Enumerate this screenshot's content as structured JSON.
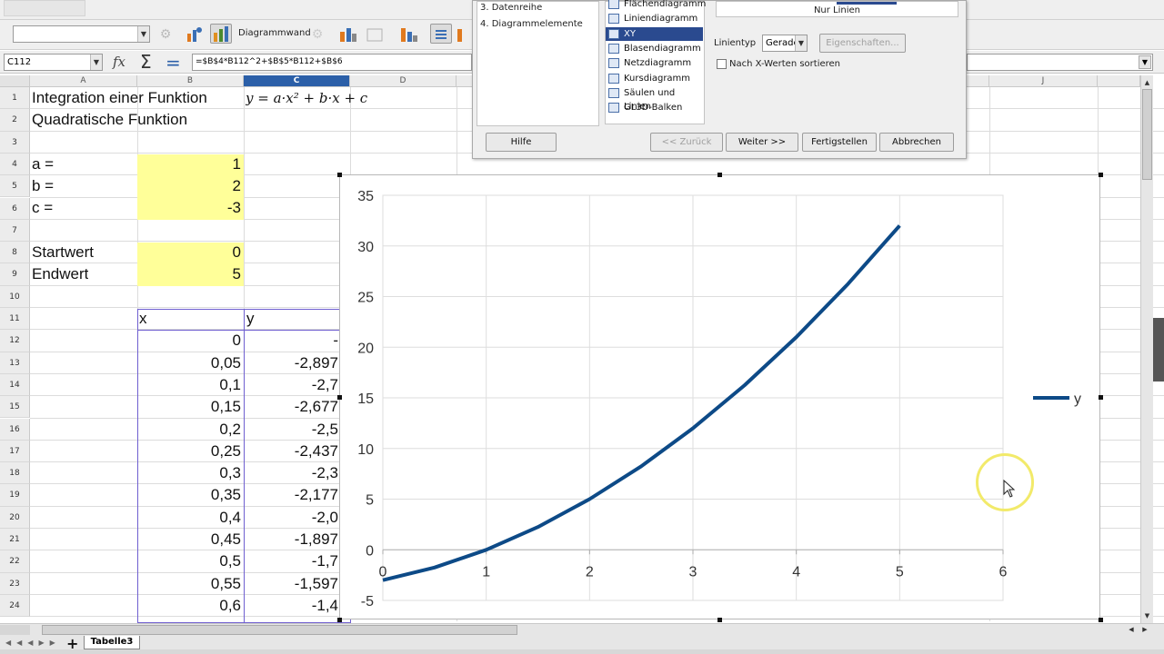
{
  "toolbar": {
    "diagrammwand_label": "Diagrammwand"
  },
  "formula_bar": {
    "name_box": "C112",
    "formula": "=$B$4*B112^2+$B$5*B112+$B$6"
  },
  "columns": [
    "A",
    "B",
    "C",
    "D",
    "J"
  ],
  "rows": [
    "1",
    "2",
    "3",
    "4",
    "5",
    "6",
    "7",
    "8",
    "9",
    "10",
    "11",
    "12",
    "13",
    "14",
    "15",
    "16",
    "17",
    "18",
    "19",
    "20",
    "21",
    "22",
    "23",
    "24"
  ],
  "cells": {
    "a1": "Integration einer Funktion",
    "c1_formula": "y = a·x² + b·x + c",
    "a2": "Quadratische Funktion",
    "a4": "a =",
    "b4": "1",
    "a5": "b =",
    "b5": "2",
    "a6": "c =",
    "b6": "-3",
    "a8": "Startwert",
    "b8": "0",
    "a9": "Endwert",
    "b9": "5",
    "b11": "x",
    "c11": "y"
  },
  "table_rows": [
    {
      "x": "0",
      "y": "-"
    },
    {
      "x": "0,05",
      "y": "-2,897"
    },
    {
      "x": "0,1",
      "y": "-2,7"
    },
    {
      "x": "0,15",
      "y": "-2,677"
    },
    {
      "x": "0,2",
      "y": "-2,5"
    },
    {
      "x": "0,25",
      "y": "-2,437"
    },
    {
      "x": "0,3",
      "y": "-2,3"
    },
    {
      "x": "0,35",
      "y": "-2,177"
    },
    {
      "x": "0,4",
      "y": "-2,0"
    },
    {
      "x": "0,45",
      "y": "-1,897"
    },
    {
      "x": "0,5",
      "y": "-1,7"
    },
    {
      "x": "0,55",
      "y": "-1,597"
    },
    {
      "x": "0,6",
      "y": "-1,4"
    }
  ],
  "dialog": {
    "steps": [
      "3. Datenreihe",
      "4. Diagrammelemente"
    ],
    "chart_types": [
      {
        "label": "Flächendiagramm",
        "selected": false
      },
      {
        "label": "Liniendiagramm",
        "selected": false
      },
      {
        "label": "XY (Streudiagramm)",
        "selected": true
      },
      {
        "label": "Blasendiagramm",
        "selected": false
      },
      {
        "label": "Netzdiagramm",
        "selected": false
      },
      {
        "label": "Kursdiagramm",
        "selected": false
      },
      {
        "label": "Säulen und Linien",
        "selected": false
      },
      {
        "label": "GL3D-Balken",
        "selected": false
      }
    ],
    "preview_caption": "Nur Linien",
    "linientyp_label": "Linientyp",
    "linientyp_value": "Gerade",
    "eigenschaften_label": "Eigenschaften...",
    "sort_checkbox_label": "Nach X-Werten sortieren",
    "buttons": {
      "hilfe": "Hilfe",
      "zurueck": "<< Zurück",
      "weiter": "Weiter >>",
      "fertig": "Fertigstellen",
      "abbrechen": "Abbrechen"
    }
  },
  "sheet_tabs": {
    "active": "Tabelle3"
  },
  "colors": {
    "series": "#0d4a87",
    "highlight": "#ffff99",
    "selection": "#2b5fa8"
  },
  "chart_data": {
    "type": "line",
    "series": [
      {
        "name": "y",
        "x": [
          0,
          0.5,
          1,
          1.5,
          2,
          2.5,
          3,
          3.5,
          4,
          4.5,
          5
        ],
        "y": [
          -3,
          -1.75,
          0,
          2.25,
          5,
          8.25,
          12,
          16.25,
          21,
          26.25,
          32
        ]
      }
    ],
    "x_ticks": [
      "0",
      "1",
      "2",
      "3",
      "4",
      "5",
      "6"
    ],
    "y_ticks": [
      "35",
      "30",
      "25",
      "20",
      "15",
      "10",
      "5",
      "0",
      "-5"
    ],
    "xlim": [
      0,
      6
    ],
    "ylim": [
      -5,
      35
    ],
    "legend_position": "right",
    "grid": true
  }
}
